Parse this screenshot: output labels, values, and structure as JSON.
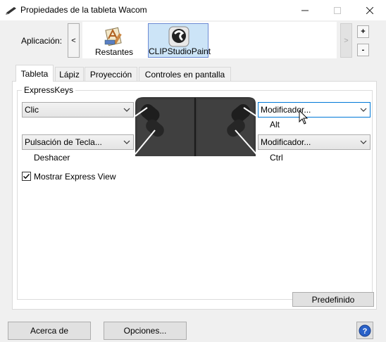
{
  "window": {
    "title": "Propiedades de la tableta Wacom"
  },
  "application": {
    "label": "Aplicación:",
    "prev_label": "<",
    "next_label": ">",
    "add_label": "+",
    "remove_label": "-",
    "items": [
      {
        "label": "Restantes"
      },
      {
        "label": "CLIPStudioPaint",
        "selected": true
      }
    ]
  },
  "tabs": [
    {
      "label": "Tableta",
      "active": true
    },
    {
      "label": "Lápiz"
    },
    {
      "label": "Proyección"
    },
    {
      "label": "Controles en pantalla"
    }
  ],
  "expresskeys": {
    "group_title": "ExpressKeys",
    "left_top": {
      "value": "Clic",
      "sublabel": ""
    },
    "left_bottom": {
      "value": "Pulsación de Tecla...",
      "sublabel": "Deshacer"
    },
    "right_top": {
      "value": "Modificador...",
      "sublabel": "Alt"
    },
    "right_bottom": {
      "value": "Modificador...",
      "sublabel": "Ctrl"
    },
    "show_express_view": {
      "label": "Mostrar Express View",
      "checked": true
    }
  },
  "buttons": {
    "default": "Predefinido",
    "about": "Acerca de",
    "options": "Opciones..."
  },
  "colors": {
    "accent": "#0078d7",
    "selected_bg": "#cce4f7",
    "device_body": "#3a3a3a"
  }
}
